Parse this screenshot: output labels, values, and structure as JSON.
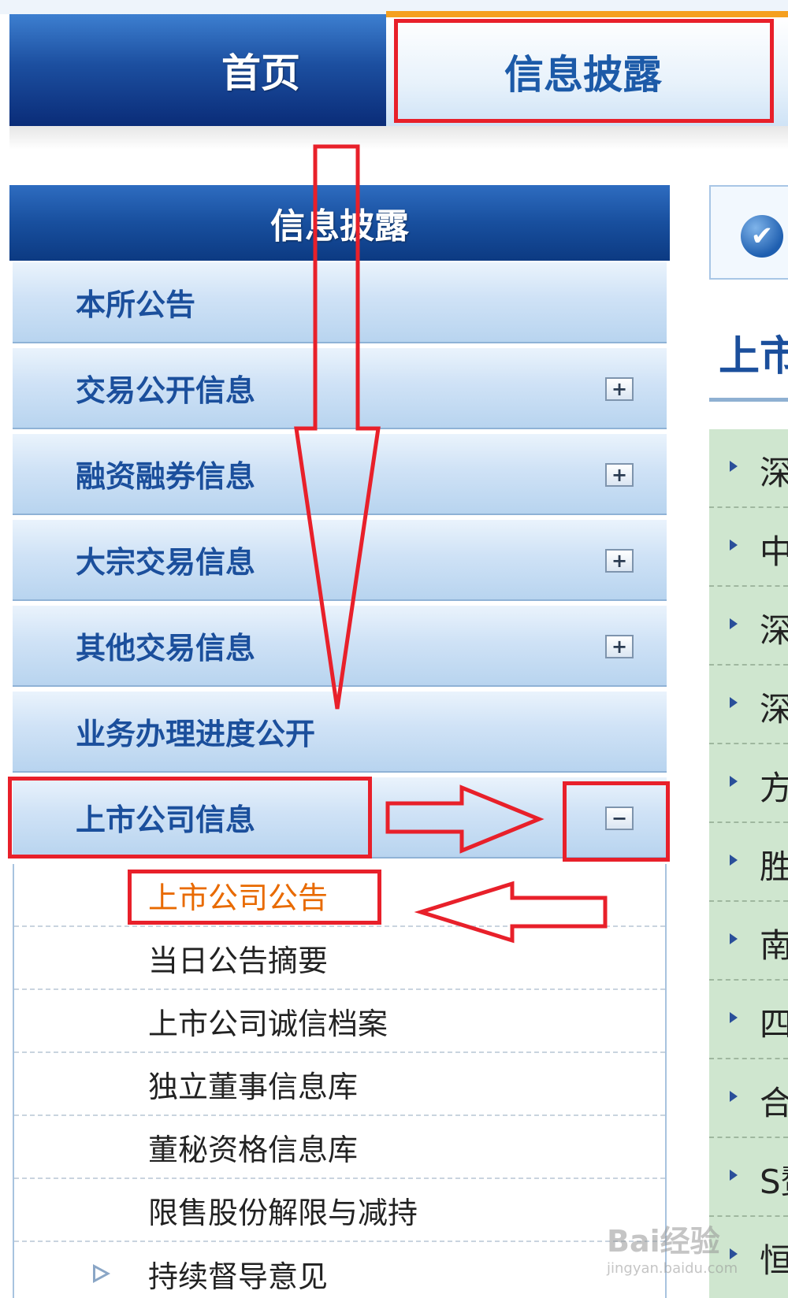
{
  "nav": {
    "home": "首页",
    "disclosure": "信息披露"
  },
  "sidebar": {
    "title": "信息披露",
    "items": [
      {
        "label": "本所公告",
        "expander": ""
      },
      {
        "label": "交易公开信息",
        "expander": "+"
      },
      {
        "label": "融资融券信息",
        "expander": "+"
      },
      {
        "label": "大宗交易信息",
        "expander": "+"
      },
      {
        "label": "其他交易信息",
        "expander": "+"
      },
      {
        "label": "业务办理进度公开",
        "expander": ""
      },
      {
        "label": "上市公司信息",
        "expander": "−"
      }
    ],
    "subitems": [
      {
        "label": "上市公司公告"
      },
      {
        "label": "当日公告摘要"
      },
      {
        "label": "上市公司诚信档案"
      },
      {
        "label": "独立董事信息库"
      },
      {
        "label": "董秘资格信息库"
      },
      {
        "label": "限售股份解限与减持"
      },
      {
        "label": "持续督导意见"
      }
    ]
  },
  "right": {
    "title": "上市",
    "rows": [
      "深",
      "中",
      "深",
      "深",
      "方",
      "胜",
      "南",
      "四",
      "合",
      "S赘",
      "恒"
    ]
  },
  "watermark": {
    "brand": "Bai经验",
    "url": "jingyan.baidu.com"
  },
  "colors": {
    "annotation": "#e8202a",
    "active_link": "#e86a00",
    "menu_text": "#1b4f9c"
  }
}
